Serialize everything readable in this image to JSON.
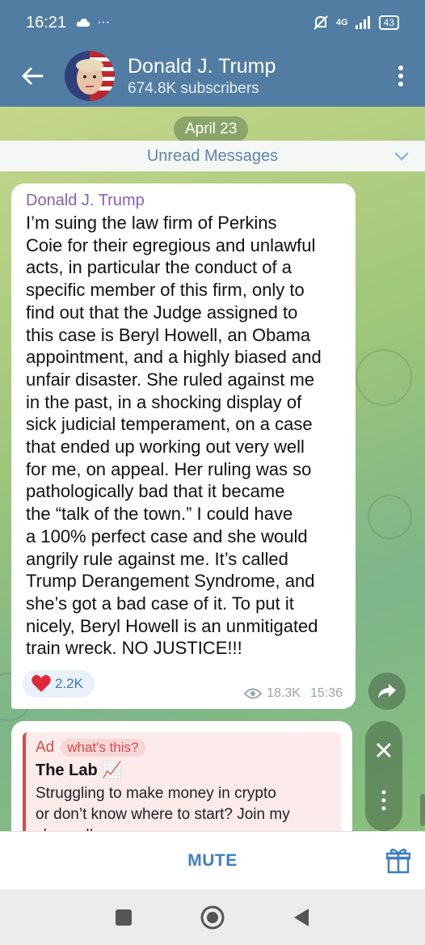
{
  "status_bar": {
    "time": "16:21",
    "dots": "···",
    "network": "4G",
    "battery": "43"
  },
  "header": {
    "title": "Donald J. Trump",
    "subtitle": "674.8K subscribers"
  },
  "chat": {
    "date_pill": "April 23",
    "unread_label": "Unread Messages",
    "message": {
      "sender": "Donald J. Trump",
      "text": "I’m suing the law firm of Perkins\nCoie for their egregious and unlawful\nacts, in particular the conduct of a\nspecific member of this firm, only to\nfind out that the Judge assigned to\nthis case is Beryl Howell, an Obama\nappointment, and a highly biased and\nunfair disaster. She ruled against me\nin the past, in a shocking display of\nsick judicial temperament, on a case\nthat ended up working out very well\nfor me, on appeal. Her ruling was so\npathologically bad that it became\nthe “talk of the town.” I could have\na 100% perfect case and she would\nangrily rule against me. It’s called\nTrump Derangement Syndrome, and\nshe’s got a bad case of it. To put it\nnicely, Beryl Howell is an unmitigated\ntrain wreck. NO JUSTICE!!!",
      "reaction_count": "2.2K",
      "views": "18.3K",
      "time": "15:36"
    },
    "ad": {
      "label": "Ad",
      "whats_this": "what's this?",
      "title": "The Lab 📈",
      "text": "Struggling to make money in crypto\nor don’t know where to start? Join my\nchannel!"
    }
  },
  "bottom_bar": {
    "mute_label": "MUTE"
  },
  "colors": {
    "header": "#517da2",
    "sender": "#8b5fb0",
    "accent": "#3f7fc0",
    "ad_red": "#d24c4c"
  }
}
